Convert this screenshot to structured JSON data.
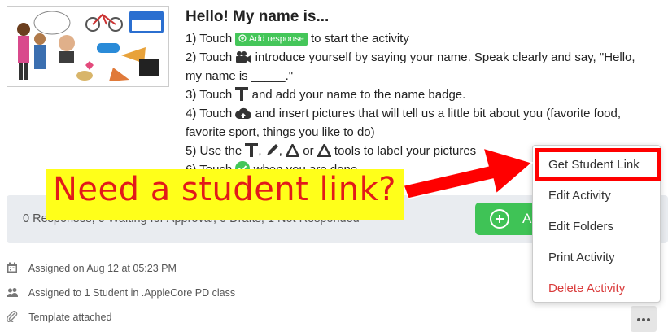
{
  "activity": {
    "title": "Hello! My name is...",
    "steps": {
      "s1_pre": "1) Touch",
      "s1_pill": "Add response",
      "s1_post": "to start the activity",
      "s2_pre": "2) Touch",
      "s2_post": "introduce yourself by saying your name. Speak clearly and say, \"Hello,",
      "s2_line2": "my name is _____.\"",
      "s3_pre": "3) Touch",
      "s3_post": "and add your name to the name badge.",
      "s4_pre": "4) Touch",
      "s4_post": "and insert pictures that will tell us a little bit about you (favorite food,",
      "s4_line2": "favorite sport, things you like to do)",
      "s5_pre": "5) Use the",
      "s5_sep1": ",",
      "s5_sep2": ",",
      "s5_or": "or",
      "s5_post": "tools to label your pictures",
      "s6_pre": "6) Touch",
      "s6_post": "when you are done"
    }
  },
  "status_bar": {
    "summary": "0 Responses, 0 Waiting for Approval, 0 Drafts, 1 Not Responded",
    "add_button_label": "A"
  },
  "meta": {
    "assigned_on": "Assigned on Aug 12 at 05:23 PM",
    "assigned_to": "Assigned to 1 Student in .AppleCore PD class",
    "template": "Template attached"
  },
  "menu": {
    "items": [
      {
        "label": "Get Student Link",
        "highlighted": true
      },
      {
        "label": "Edit Activity"
      },
      {
        "label": "Edit Folders"
      },
      {
        "label": "Print Activity"
      },
      {
        "label": "Delete Activity",
        "danger": true
      }
    ]
  },
  "callout": {
    "text": "Need a student link?"
  },
  "colors": {
    "accent_green": "#3fc356",
    "danger_red": "#d93a3a",
    "callout_yellow": "#ffff1a",
    "annotation_red": "#ff0000"
  },
  "icons": {
    "video": "video-camera-icon",
    "text": "text-tool-icon",
    "upload": "cloud-upload-icon",
    "pen": "pen-tool-icon",
    "shape": "shape-tool-icon",
    "check": "check-circle-icon",
    "calendar": "calendar-icon",
    "people": "people-icon",
    "paperclip": "paperclip-icon",
    "more": "more-dots-icon"
  }
}
